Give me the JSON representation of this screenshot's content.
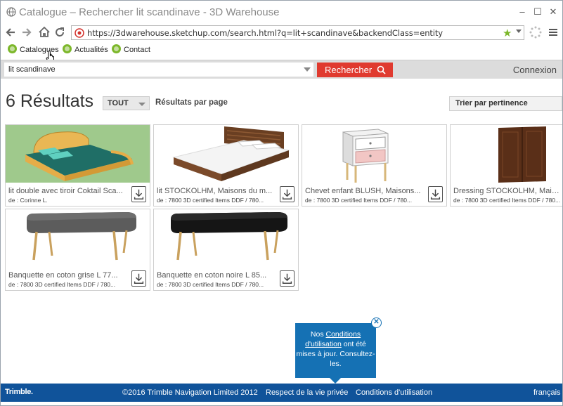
{
  "window": {
    "title": "Catalogue – Rechercher lit scandinave - 3D Warehouse",
    "minimize": "–",
    "maximize": "☐",
    "close": "✕"
  },
  "address_bar": {
    "url": "https://3dwarehouse.sketchup.com/search.html?q=lit+scandinave&backendClass=entity"
  },
  "bookmarks": [
    {
      "label": "Catalogues"
    },
    {
      "label": "Actualités"
    },
    {
      "label": "Contact"
    }
  ],
  "search": {
    "query": "lit scandinave",
    "button_label": "Rechercher",
    "login_label": "Connexion"
  },
  "results": {
    "count_label": "6 Résultats",
    "filter_value": "TOUT",
    "per_page_label": "Résultats par page",
    "sort_value": "Trier par pertinence"
  },
  "cards": [
    {
      "name": "lit double avec tiroir Coktail Sca...",
      "author": "de : Corinne L."
    },
    {
      "name": "lit STOCKOLHM, Maisons du m...",
      "author": "de : 7800 3D certified Items DDF / 780..."
    },
    {
      "name": "Chevet enfant BLUSH, Maisons...",
      "author": "de : 7800 3D certified Items DDF / 780..."
    },
    {
      "name": "Dressing STOCKOLHM, Maisons",
      "author": "de : 7800 3D certified Items DDF / 780..."
    },
    {
      "name": "Banquette en coton grise L 77...",
      "author": "de : 7800 3D certified Items DDF / 780..."
    },
    {
      "name": "Banquette en coton noire L 85...",
      "author": "de : 7800 3D certified Items DDF / 780..."
    }
  ],
  "notice": {
    "prefix": "Nos ",
    "link": "Conditions d'utilisation",
    "suffix": " ont été mises à jour. Consultez-les."
  },
  "footer": {
    "logo": "Trimble.",
    "copyright": "©2016 Trimble Navigation Limited 2012",
    "privacy": "Respect de la vie privée",
    "terms": "Conditions d'utilisation",
    "language": "français"
  },
  "colors": {
    "search_button": "#e03a2f",
    "footer": "#10539a",
    "tooltip": "#1571b4",
    "bookmark_icon": "#7cb72a"
  }
}
